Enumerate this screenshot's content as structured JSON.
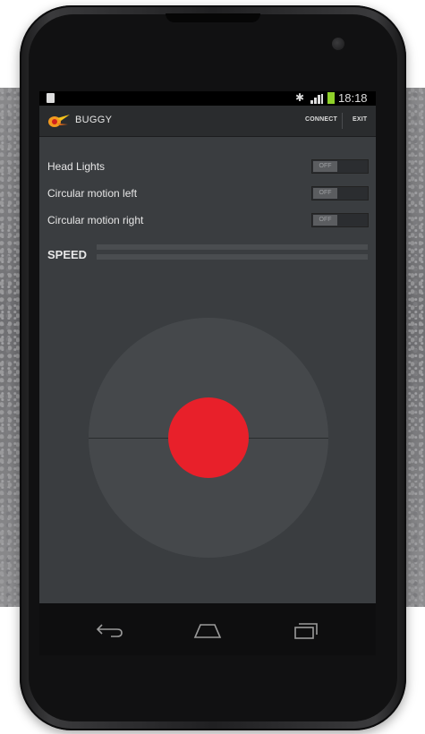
{
  "status_bar": {
    "time": "18:18",
    "icons": [
      "notification-icon",
      "bluetooth-icon",
      "signal-icon",
      "battery-icon"
    ],
    "battery_color": "#8fd12a"
  },
  "action_bar": {
    "app_title": "BUGGY",
    "connect_label": "CONNECT",
    "exit_label": "EXIT"
  },
  "controls": {
    "toggles": [
      {
        "label": "Head Lights",
        "state": "OFF"
      },
      {
        "label": "Circular motion left",
        "state": "OFF"
      },
      {
        "label": "Circular motion right",
        "state": "OFF"
      }
    ],
    "speed": {
      "label": "SPEED",
      "level": 0
    }
  },
  "joystick": {
    "knob_color": "#e8202a"
  },
  "nav_bar": {
    "icons": [
      "back-icon",
      "home-icon",
      "recent-apps-icon"
    ]
  }
}
